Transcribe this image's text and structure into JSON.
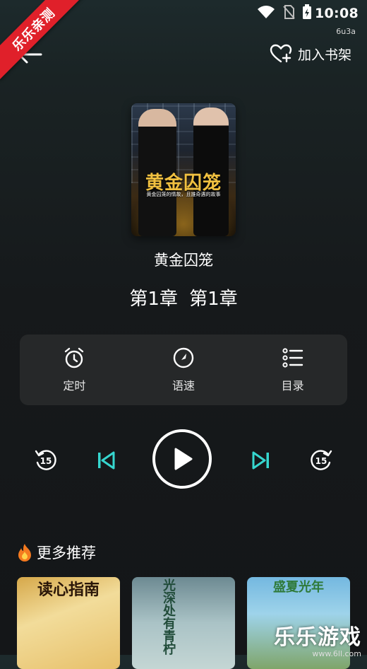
{
  "status": {
    "time": "10:08",
    "sub": "6u3a"
  },
  "watermark": {
    "ribbon": "乐乐亲测",
    "brand": "乐乐游戏",
    "site": "www.6ll.com"
  },
  "header": {
    "add_shelf_label": "加入书架"
  },
  "book": {
    "cover_title": "黄金囚笼",
    "cover_subtitle": "黄金囚笼的情故，且誰奇遇的故事",
    "title": "黄金囚笼",
    "chapter": "第1章 第1章"
  },
  "controls": {
    "timer_label": "定时",
    "speed_label": "语速",
    "toc_label": "目录"
  },
  "playback": {
    "rewind_seconds": "15",
    "forward_seconds": "15"
  },
  "recommend": {
    "title": "更多推荐",
    "items": [
      {
        "cover_text": "读心指南"
      },
      {
        "cover_text": "光深处有青柠"
      },
      {
        "cover_text": "盛夏光年"
      }
    ]
  },
  "colors": {
    "accent": "#36d6cf",
    "ribbon": "#e0202a",
    "panel": "#262829"
  }
}
